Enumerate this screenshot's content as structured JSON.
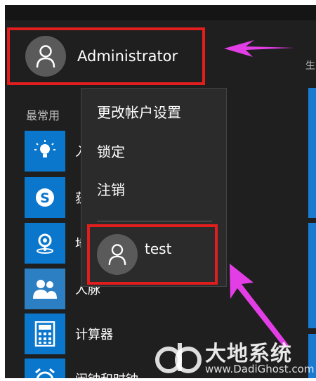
{
  "account": {
    "name": "Administrator"
  },
  "section_label": "最常用",
  "right_label": "生",
  "apps": [
    {
      "label": "入",
      "icon": "lightbulb-icon"
    },
    {
      "label": "获",
      "icon": "skype-icon"
    },
    {
      "label": "地",
      "icon": "maps-pin-icon"
    },
    {
      "label": "人脉",
      "icon": "people-icon"
    },
    {
      "label": "计算器",
      "icon": "calculator-icon"
    },
    {
      "label": "闹钟和时钟",
      "icon": "alarm-clock-icon"
    }
  ],
  "context_menu": {
    "items": [
      "更改帐户设置",
      "锁定",
      "注销"
    ],
    "other_account": "test"
  },
  "annotations": {
    "highlight_color": "#e01e1e",
    "arrow_color": "#e33ee6"
  },
  "watermark": {
    "brand": "大地系统",
    "url": "www.DadiGhost.com"
  }
}
